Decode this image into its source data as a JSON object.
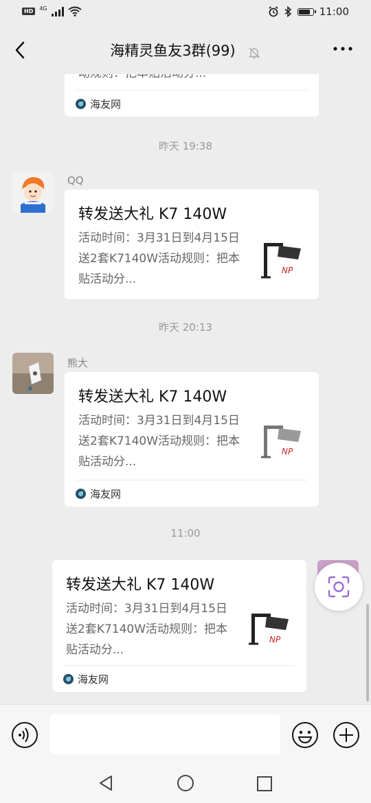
{
  "status_bar": {
    "hd": "HD",
    "network": "4G",
    "time": "11:00",
    "battery_level": 0.85
  },
  "header": {
    "title": "海精灵鱼友3群(99)"
  },
  "top_card": {
    "desc_tail": "动规则：把本贴活动分...",
    "source": "海友网"
  },
  "messages": [
    {
      "time": "昨天 19:38",
      "sender": "QQ",
      "title": "转发送大礼 K7 140W",
      "desc": "活动时间：3月31日到4月15日送2套K7140W活动规则：把本贴活动分..."
    },
    {
      "time": "昨天 20:13",
      "sender": "熊大",
      "title": "转发送大礼 K7 140W",
      "desc": "活动时间：3月31日到4月15日送2套K7140W活动规则：把本贴活动分...",
      "source": "海友网"
    },
    {
      "time": "11:00",
      "title": "转发送大礼 K7 140W",
      "desc": "活动时间：3月31日到4月15日送2套K7140W活动规则：把本贴活动分...",
      "source": "海友网"
    }
  ],
  "input": {
    "placeholder": ""
  },
  "colors": {
    "background": "#ededed",
    "card": "#ffffff",
    "accent_purple": "#9b6bd6",
    "text_muted": "#999999"
  }
}
